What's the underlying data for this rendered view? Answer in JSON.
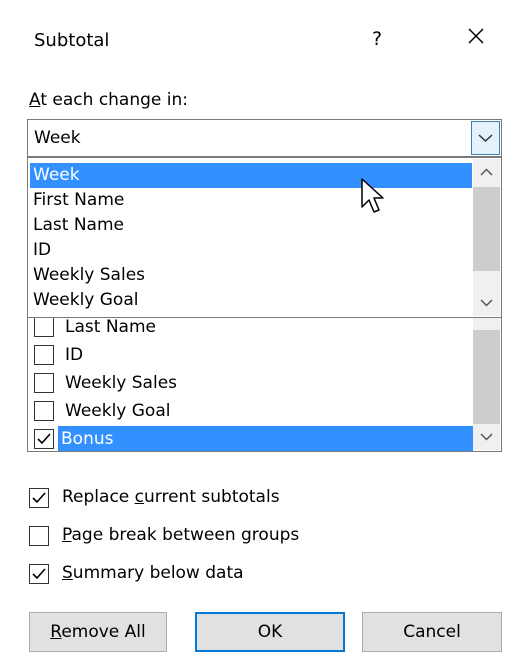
{
  "dialog": {
    "title": "Subtotal",
    "help_label": "?",
    "close_label": "✕"
  },
  "group_by": {
    "label_accel": "A",
    "label_rest": "t each change in:",
    "selected": "Week",
    "dropdown_items": [
      "Week",
      "First Name",
      "Last Name",
      "ID",
      "Weekly Sales",
      "Weekly Goal"
    ],
    "highlighted_index": 0
  },
  "add_subtotal_to": {
    "items": [
      {
        "label": "Last Name",
        "checked": false
      },
      {
        "label": "ID",
        "checked": false
      },
      {
        "label": "Weekly Sales",
        "checked": false
      },
      {
        "label": "Weekly Goal",
        "checked": false
      },
      {
        "label": "Bonus",
        "checked": true
      }
    ],
    "selected_index": 4
  },
  "options": {
    "replace_pre": "Replace ",
    "replace_accel": "c",
    "replace_post": "urrent subtotals",
    "replace_checked": true,
    "pagebreak_accel": "P",
    "pagebreak_post": "age break between groups",
    "pagebreak_checked": false,
    "summary_accel": "S",
    "summary_post": "ummary below data",
    "summary_checked": true
  },
  "buttons": {
    "remove_accel": "R",
    "remove_rest": "emove All",
    "ok": "OK",
    "cancel": "Cancel"
  },
  "colors": {
    "selection": "#3390ff",
    "primary_border": "#0078d7",
    "button_bg": "#e1e1e1"
  }
}
